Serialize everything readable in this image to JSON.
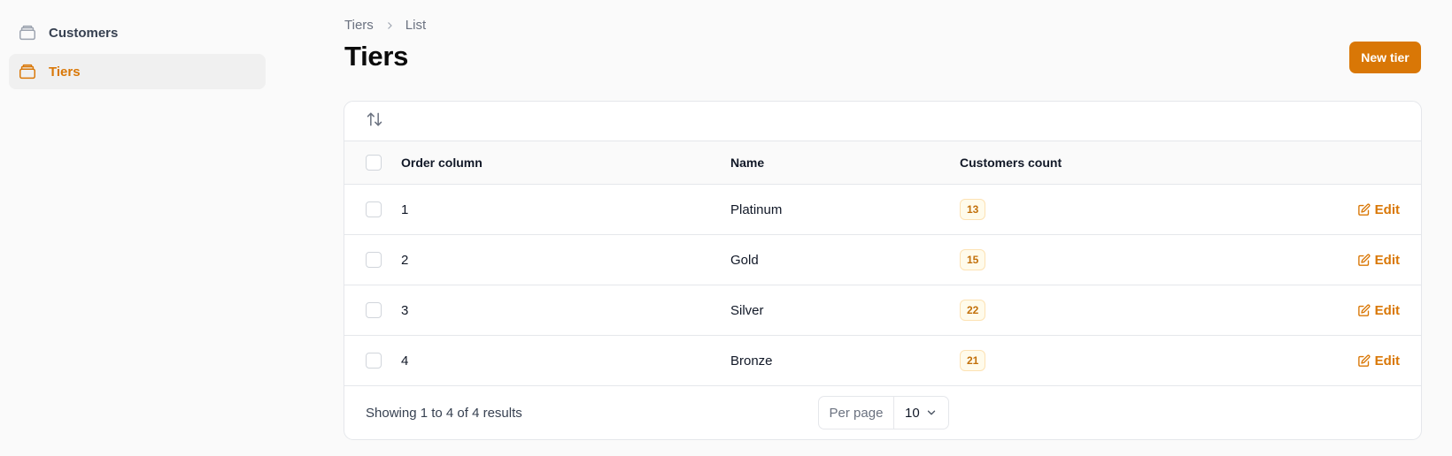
{
  "sidebar": {
    "items": [
      {
        "label": "Customers",
        "icon": "stack-icon",
        "active": false
      },
      {
        "label": "Tiers",
        "icon": "stack-icon",
        "active": true
      }
    ]
  },
  "header": {
    "breadcrumb": [
      "Tiers",
      "List"
    ],
    "title": "Tiers",
    "new_button": "New tier"
  },
  "table": {
    "columns": [
      "Order column",
      "Name",
      "Customers count"
    ],
    "rows": [
      {
        "order": "1",
        "name": "Platinum",
        "count": "13",
        "action": "Edit"
      },
      {
        "order": "2",
        "name": "Gold",
        "count": "15",
        "action": "Edit"
      },
      {
        "order": "3",
        "name": "Silver",
        "count": "22",
        "action": "Edit"
      },
      {
        "order": "4",
        "name": "Bronze",
        "count": "21",
        "action": "Edit"
      }
    ],
    "summary": "Showing 1 to 4 of 4 results",
    "per_page_label": "Per page",
    "per_page_value": "10"
  },
  "colors": {
    "accent": "#d97706",
    "badge_bg": "#fffbeb"
  }
}
